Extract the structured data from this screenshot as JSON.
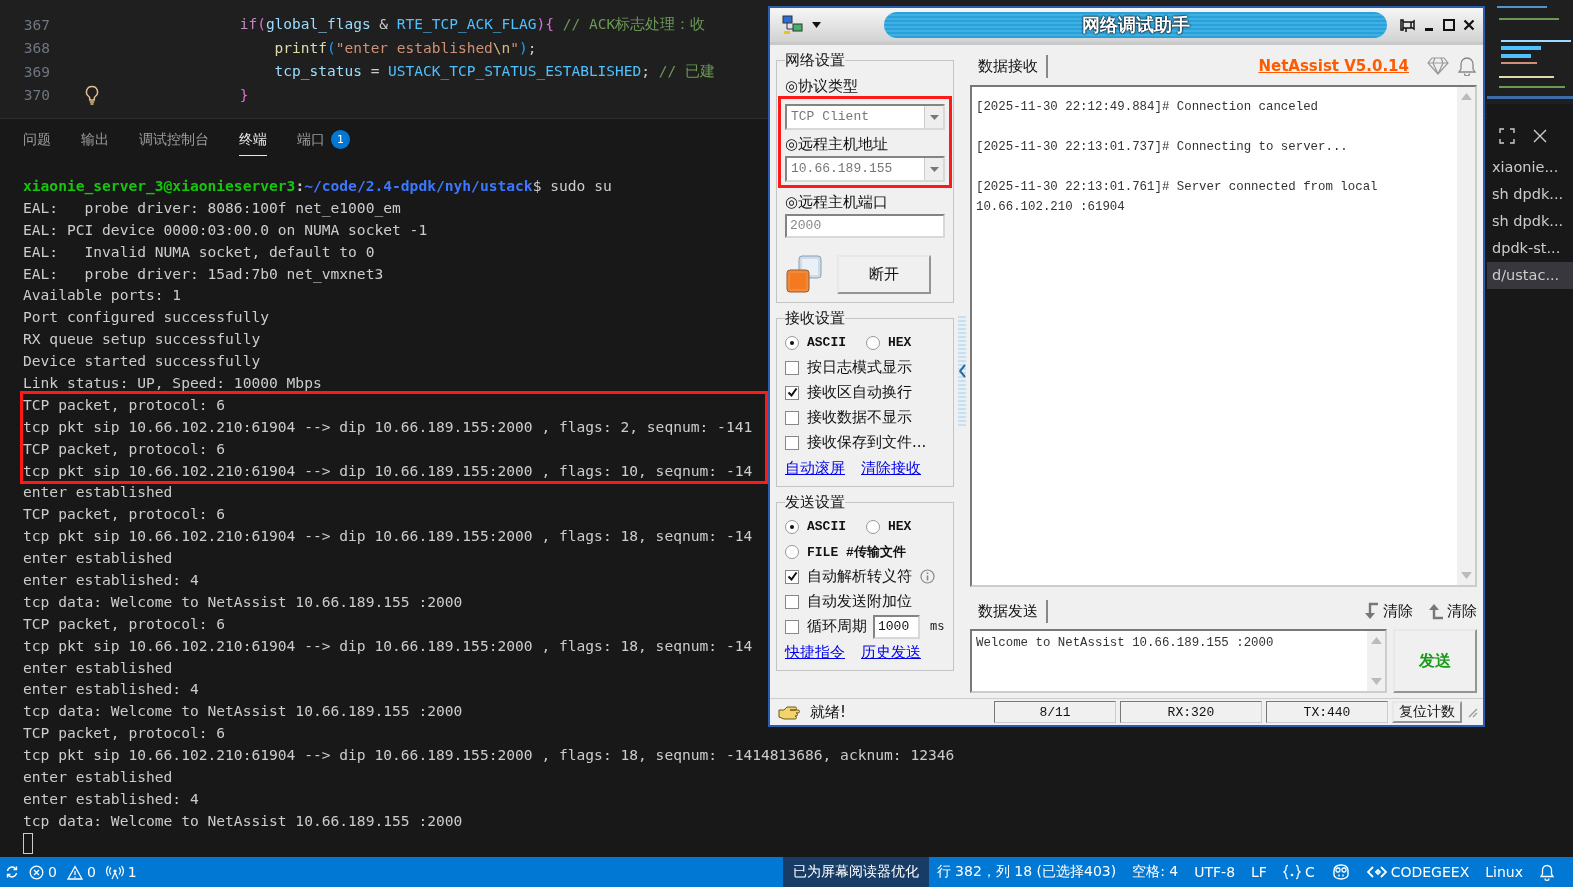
{
  "editor": {
    "lines": [
      {
        "number": "367",
        "lightbulb": false,
        "tokens": [
          {
            "text": "                if",
            "kind": "keyword"
          },
          {
            "text": "(",
            "kind": "bracket2"
          },
          {
            "text": "global_flags",
            "kind": "variable"
          },
          {
            "text": " & ",
            "kind": "plain"
          },
          {
            "text": "RTE_TCP_ACK_FLAG",
            "kind": "constant"
          },
          {
            "text": ")",
            "kind": "bracket2"
          },
          {
            "text": "{",
            "kind": "bracket2"
          },
          {
            "text": " // ACK标志处理：收",
            "kind": "comment"
          }
        ]
      },
      {
        "number": "368",
        "lightbulb": false,
        "tokens": [
          {
            "text": "                    printf",
            "kind": "function"
          },
          {
            "text": "(",
            "kind": "bracket3"
          },
          {
            "text": "\"enter established",
            "kind": "string"
          },
          {
            "text": "\\n",
            "kind": "escape"
          },
          {
            "text": "\"",
            "kind": "string"
          },
          {
            "text": ")",
            "kind": "bracket3"
          },
          {
            "text": ";",
            "kind": "plain"
          }
        ]
      },
      {
        "number": "369",
        "lightbulb": false,
        "tokens": [
          {
            "text": "                    tcp_status",
            "kind": "variable"
          },
          {
            "text": " = ",
            "kind": "plain"
          },
          {
            "text": "USTACK_TCP_STATUS_ESTABLISHED",
            "kind": "constant"
          },
          {
            "text": "; ",
            "kind": "plain"
          },
          {
            "text": "// 已建",
            "kind": "comment"
          }
        ]
      },
      {
        "number": "370",
        "lightbulb": true,
        "tokens": [
          {
            "text": "                }",
            "kind": "bracket2"
          }
        ]
      }
    ]
  },
  "panel_tabs": [
    {
      "label": "问题",
      "selected": false
    },
    {
      "label": "输出",
      "selected": false
    },
    {
      "label": "调试控制台",
      "selected": false
    },
    {
      "label": "终端",
      "selected": true
    },
    {
      "label": "端口",
      "selected": false,
      "badge": "1"
    }
  ],
  "terminal": {
    "prompt": {
      "user_host": "xiaonie_server_3@xiaonieserver3",
      "separator": ":",
      "path": "~/code/2.4-dpdk/nyh/ustack",
      "command": "$ sudo su"
    },
    "blocks": [
      {
        "highlighted": false,
        "lines": [
          "EAL:   probe driver: 8086:100f net_e1000_em",
          "EAL: PCI device 0000:03:00.0 on NUMA socket -1",
          "EAL:   Invalid NUMA socket, default to 0",
          "EAL:   probe driver: 15ad:7b0 net_vmxnet3",
          "Available ports: 1",
          "Port configured successfully",
          "RX queue setup successfully",
          "Device started successfully",
          "Link status: UP, Speed: 10000 Mbps"
        ]
      },
      {
        "highlighted": true,
        "lines": [
          "TCP packet, protocol: 6",
          "tcp pkt sip 10.66.102.210:61904 --> dip 10.66.189.155:2000 , flags: 2, seqnum: -141",
          "TCP packet, protocol: 6",
          "tcp pkt sip 10.66.102.210:61904 --> dip 10.66.189.155:2000 , flags: 10, seqnum: -14"
        ]
      },
      {
        "highlighted": false,
        "lines": [
          "enter established",
          "TCP packet, protocol: 6",
          "tcp pkt sip 10.66.102.210:61904 --> dip 10.66.189.155:2000 , flags: 18, seqnum: -14",
          "enter established",
          "enter established: 4",
          "tcp data: Welcome to NetAssist 10.66.189.155 :2000",
          "TCP packet, protocol: 6",
          "tcp pkt sip 10.66.102.210:61904 --> dip 10.66.189.155:2000 , flags: 18, seqnum: -14",
          "enter established",
          "enter established: 4",
          "tcp data: Welcome to NetAssist 10.66.189.155 :2000",
          "TCP packet, protocol: 6",
          "tcp pkt sip 10.66.102.210:61904 --> dip 10.66.189.155:2000 , flags: 18, seqnum: -1414813686, acknum: 12346",
          "enter established",
          "enter established: 4",
          "tcp data: Welcome to NetAssist 10.66.189.155 :2000"
        ]
      }
    ]
  },
  "terminal_list": [
    {
      "label": "xiaonie...",
      "selected": false
    },
    {
      "label": "sh  dpdk...",
      "selected": false
    },
    {
      "label": "sh  dpdk...",
      "selected": false
    },
    {
      "label": "dpdk-st...",
      "selected": false
    },
    {
      "label": "d/ustac...",
      "selected": true
    }
  ],
  "status_bar": {
    "left": [
      {
        "kind": "sync"
      },
      {
        "kind": "errors",
        "text": "0"
      },
      {
        "kind": "warnings",
        "text": "0"
      },
      {
        "kind": "ports",
        "text": "1"
      }
    ],
    "right": [
      {
        "kind": "highlight",
        "text": "已为屏幕阅读器优化"
      },
      {
        "kind": "text",
        "text": "行 382，列 18 (已选择403)"
      },
      {
        "kind": "text",
        "text": "空格: 4"
      },
      {
        "kind": "text",
        "text": "UTF-8"
      },
      {
        "kind": "text",
        "text": "LF"
      },
      {
        "kind": "language",
        "text": "C"
      },
      {
        "kind": "copilot"
      },
      {
        "kind": "codegeex",
        "text": "CODEGEEX"
      },
      {
        "kind": "text",
        "text": "Linux"
      },
      {
        "kind": "bell"
      }
    ]
  },
  "netassist": {
    "title": "网络调试助手",
    "version": "NetAssist V5.0.14",
    "network_settings": {
      "title": "网络设置",
      "protocol_label": "◎协议类型",
      "highlight": {
        "highlighted": true,
        "protocol_value": "TCP Client",
        "address_label": "◎远程主机地址",
        "address_value": "10.66.189.155"
      },
      "port_label": "◎远程主机端口",
      "port_value": "2000",
      "connect_button": "断开"
    },
    "receive_settings": {
      "title": "接收设置",
      "encodings": [
        {
          "label": "ASCII",
          "selected": true
        },
        {
          "label": "HEX",
          "selected": false
        }
      ],
      "options": [
        {
          "label": "按日志模式显示",
          "checked": false
        },
        {
          "label": "接收区自动换行",
          "checked": true
        },
        {
          "label": "接收数据不显示",
          "checked": false
        },
        {
          "label": "接收保存到文件...",
          "checked": false
        }
      ],
      "links": [
        "自动滚屏",
        "清除接收"
      ]
    },
    "send_settings": {
      "title": "发送设置",
      "modes": [
        {
          "label": "ASCII",
          "selected": true
        },
        {
          "label": "HEX",
          "selected": false
        },
        {
          "label": "FILE #传输文件",
          "selected": false
        }
      ],
      "options": [
        {
          "label": "自动解析转义符",
          "checked": true,
          "info": true
        },
        {
          "label": "自动发送附加位",
          "checked": false
        },
        {
          "label": "循环周期",
          "checked": false,
          "value": "1000",
          "unit": "ms"
        }
      ],
      "links": [
        "快捷指令",
        "历史发送"
      ]
    },
    "receive": {
      "tab": "数据接收",
      "entries": [
        "[2025-11-30 22:12:49.884]# Connection canceled",
        "[2025-11-30 22:13:01.737]# Connecting to server...",
        "[2025-11-30 22:13:01.761]# Server connected from local 10.66.102.210 :61904"
      ]
    },
    "send": {
      "tab": "数据发送",
      "clear_buttons": [
        {
          "kind": "down",
          "label": "清除"
        },
        {
          "kind": "up",
          "label": "清除"
        }
      ],
      "text": "Welcome to NetAssist 10.66.189.155 :2000",
      "send_button": "发送"
    },
    "status": {
      "message": "就绪!",
      "counters": [
        "8/11",
        "RX:320",
        "TX:440"
      ],
      "reset_button": "复位计数"
    }
  }
}
